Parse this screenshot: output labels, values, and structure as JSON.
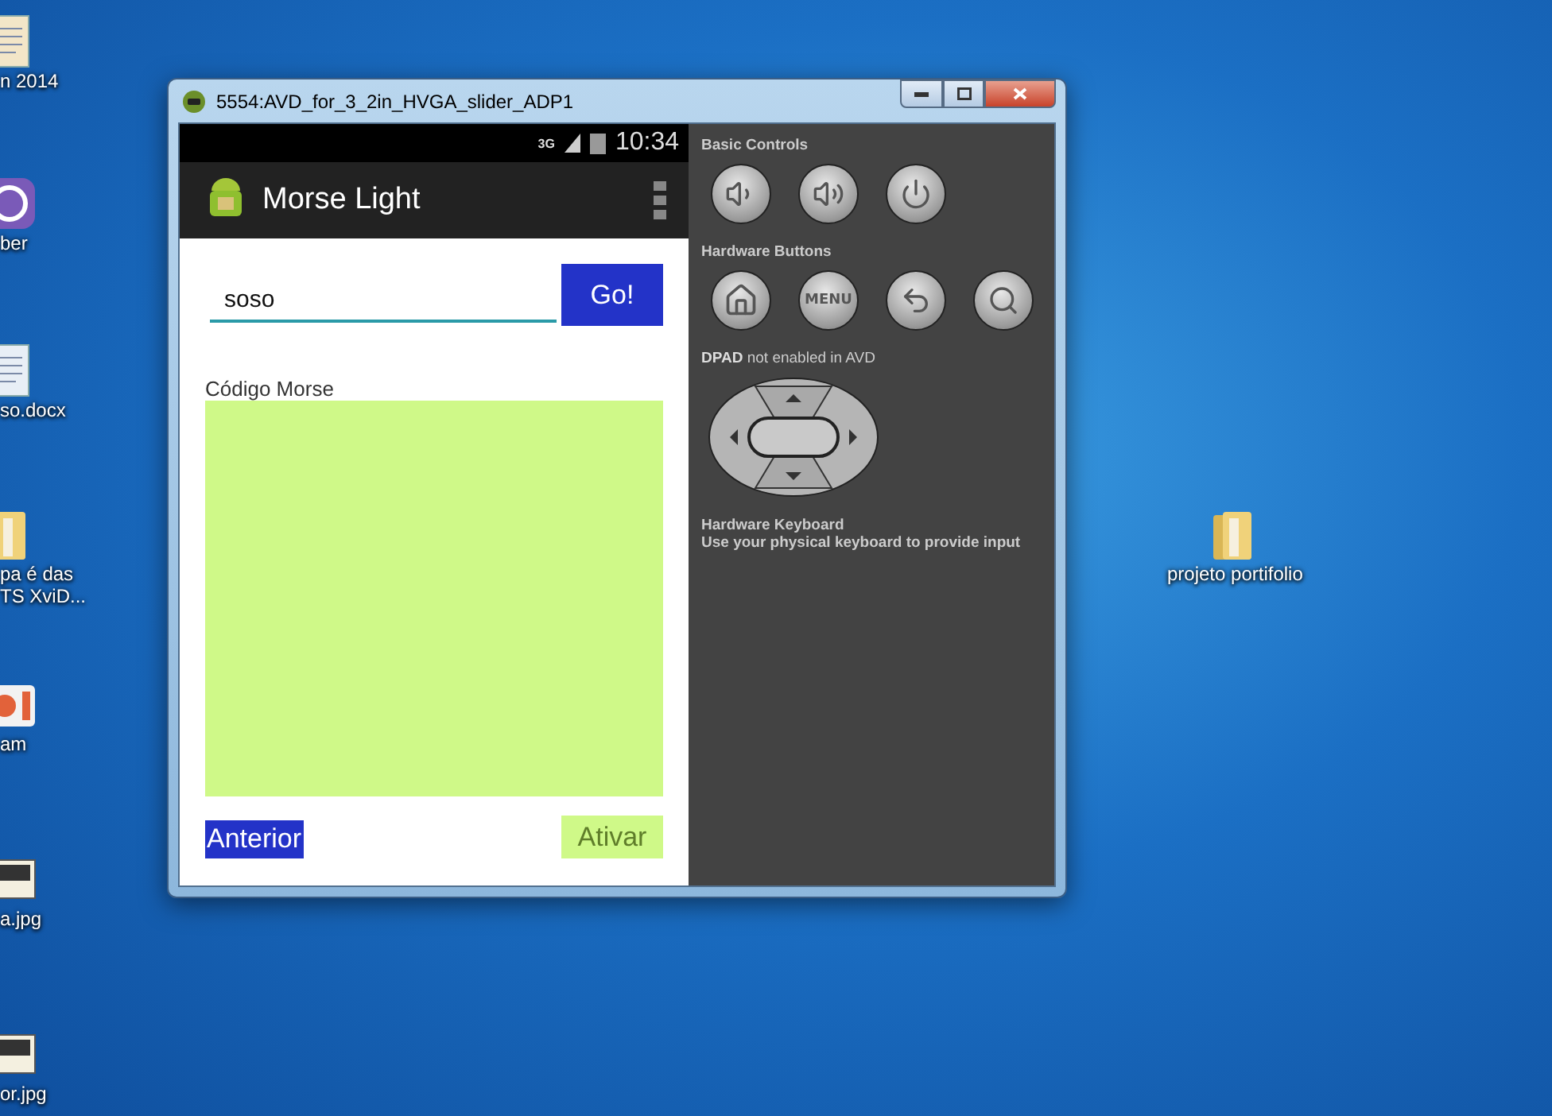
{
  "desktop_icons": [
    {
      "kind": "document",
      "lines": [
        "n 2014"
      ]
    },
    {
      "kind": "app",
      "lines": [
        "ber"
      ]
    },
    {
      "kind": "docx",
      "lines": [
        "so.docx"
      ]
    },
    {
      "kind": "folder",
      "lines": [
        "pa é das",
        "TS XviD..."
      ]
    },
    {
      "kind": "camera",
      "lines": [
        "am"
      ]
    },
    {
      "kind": "image",
      "lines": [
        "a.jpg"
      ]
    },
    {
      "kind": "image",
      "lines": [
        "or.jpg"
      ]
    }
  ],
  "folder_icon": {
    "kind": "folder",
    "lines": [
      "projeto portifolio"
    ]
  },
  "window": {
    "title": "5554:AVD_for_3_2in_HVGA_slider_ADP1",
    "phone": {
      "status_bar": {
        "network": "3G",
        "time": "10:34"
      },
      "action_bar": {
        "title": "Morse Light"
      },
      "input": {
        "value": "soso"
      },
      "go_button": {
        "label": "Go!"
      },
      "morse_label": "Código Morse",
      "buttons": [
        {
          "label": "Anterior",
          "disabled": false
        },
        {
          "label": "Ativar",
          "disabled": true
        }
      ]
    },
    "controls": {
      "sections": [
        {
          "kind": "buttons",
          "title": "Basic Controls",
          "buttons": [
            {
              "kind": "volume_down"
            },
            {
              "kind": "volume_up"
            },
            {
              "kind": "power"
            }
          ]
        },
        {
          "kind": "buttons",
          "title": "Hardware Buttons",
          "buttons": [
            {
              "kind": "home"
            },
            {
              "kind": "menu",
              "label": "MENU"
            },
            {
              "kind": "back"
            },
            {
              "kind": "search"
            }
          ]
        },
        {
          "kind": "dpad",
          "title": "**DPAD** not enabled in AVD"
        },
        {
          "kind": "text",
          "title": "Hardware Keyboard",
          "text": "Use your physical keyboard to provide input"
        }
      ]
    }
  }
}
